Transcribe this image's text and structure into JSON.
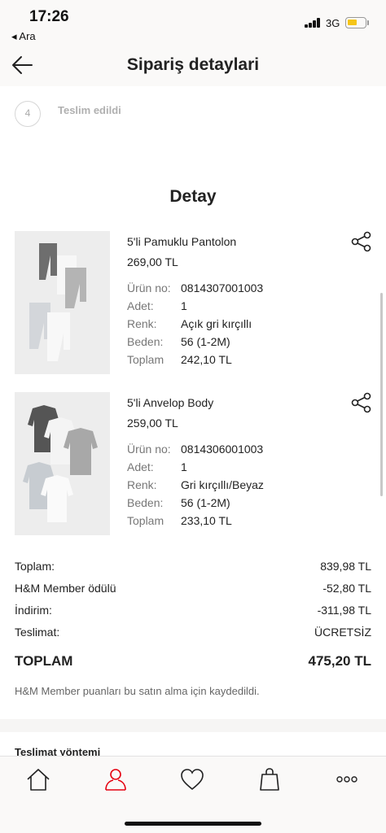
{
  "status_bar": {
    "time": "17:26",
    "back_app": "◂ Ara",
    "network": "3G"
  },
  "header": {
    "title": "Sipariş detaylari"
  },
  "step": {
    "number": "4",
    "label": "Teslim edildi"
  },
  "detail_title": "Detay",
  "labels": {
    "product_no": "Ürün no:",
    "quantity": "Adet:",
    "color": "Renk:",
    "size": "Beden:",
    "total": "Toplam"
  },
  "items": [
    {
      "name": "5'li Pamuklu Pantolon",
      "price": "269,00 TL",
      "product_no": "0814307001003",
      "quantity": "1",
      "color": "Açık gri kırçıllı",
      "size": "56 (1-2M)",
      "total": "242,10 TL"
    },
    {
      "name": "5'li Anvelop Body",
      "price": "259,00 TL",
      "product_no": "0814306001003",
      "quantity": "1",
      "color": "Gri kırçıllı/Beyaz",
      "size": "56 (1-2M)",
      "total": "233,10 TL"
    }
  ],
  "summary": {
    "subtotal_label": "Toplam:",
    "subtotal": "839,98 TL",
    "member_label": "H&M Member ödülü",
    "member": "-52,80 TL",
    "discount_label": "İndirim:",
    "discount": "-311,98 TL",
    "delivery_label": "Teslimat:",
    "delivery": "ÜCRETSİZ",
    "total_label": "TOPLAM",
    "total": "475,20 TL",
    "member_note": "H&M Member puanları bu satın alma için kaydedildi."
  },
  "delivery_section": {
    "label": "Teslimat yöntemi"
  },
  "colors": {
    "accent": "#e50010",
    "battery": "#f5c518",
    "background": "#faf9f8"
  },
  "tabs": [
    {
      "icon": "home-icon"
    },
    {
      "icon": "account-icon",
      "active": true
    },
    {
      "icon": "heart-icon"
    },
    {
      "icon": "bag-icon"
    },
    {
      "icon": "more-icon"
    }
  ]
}
